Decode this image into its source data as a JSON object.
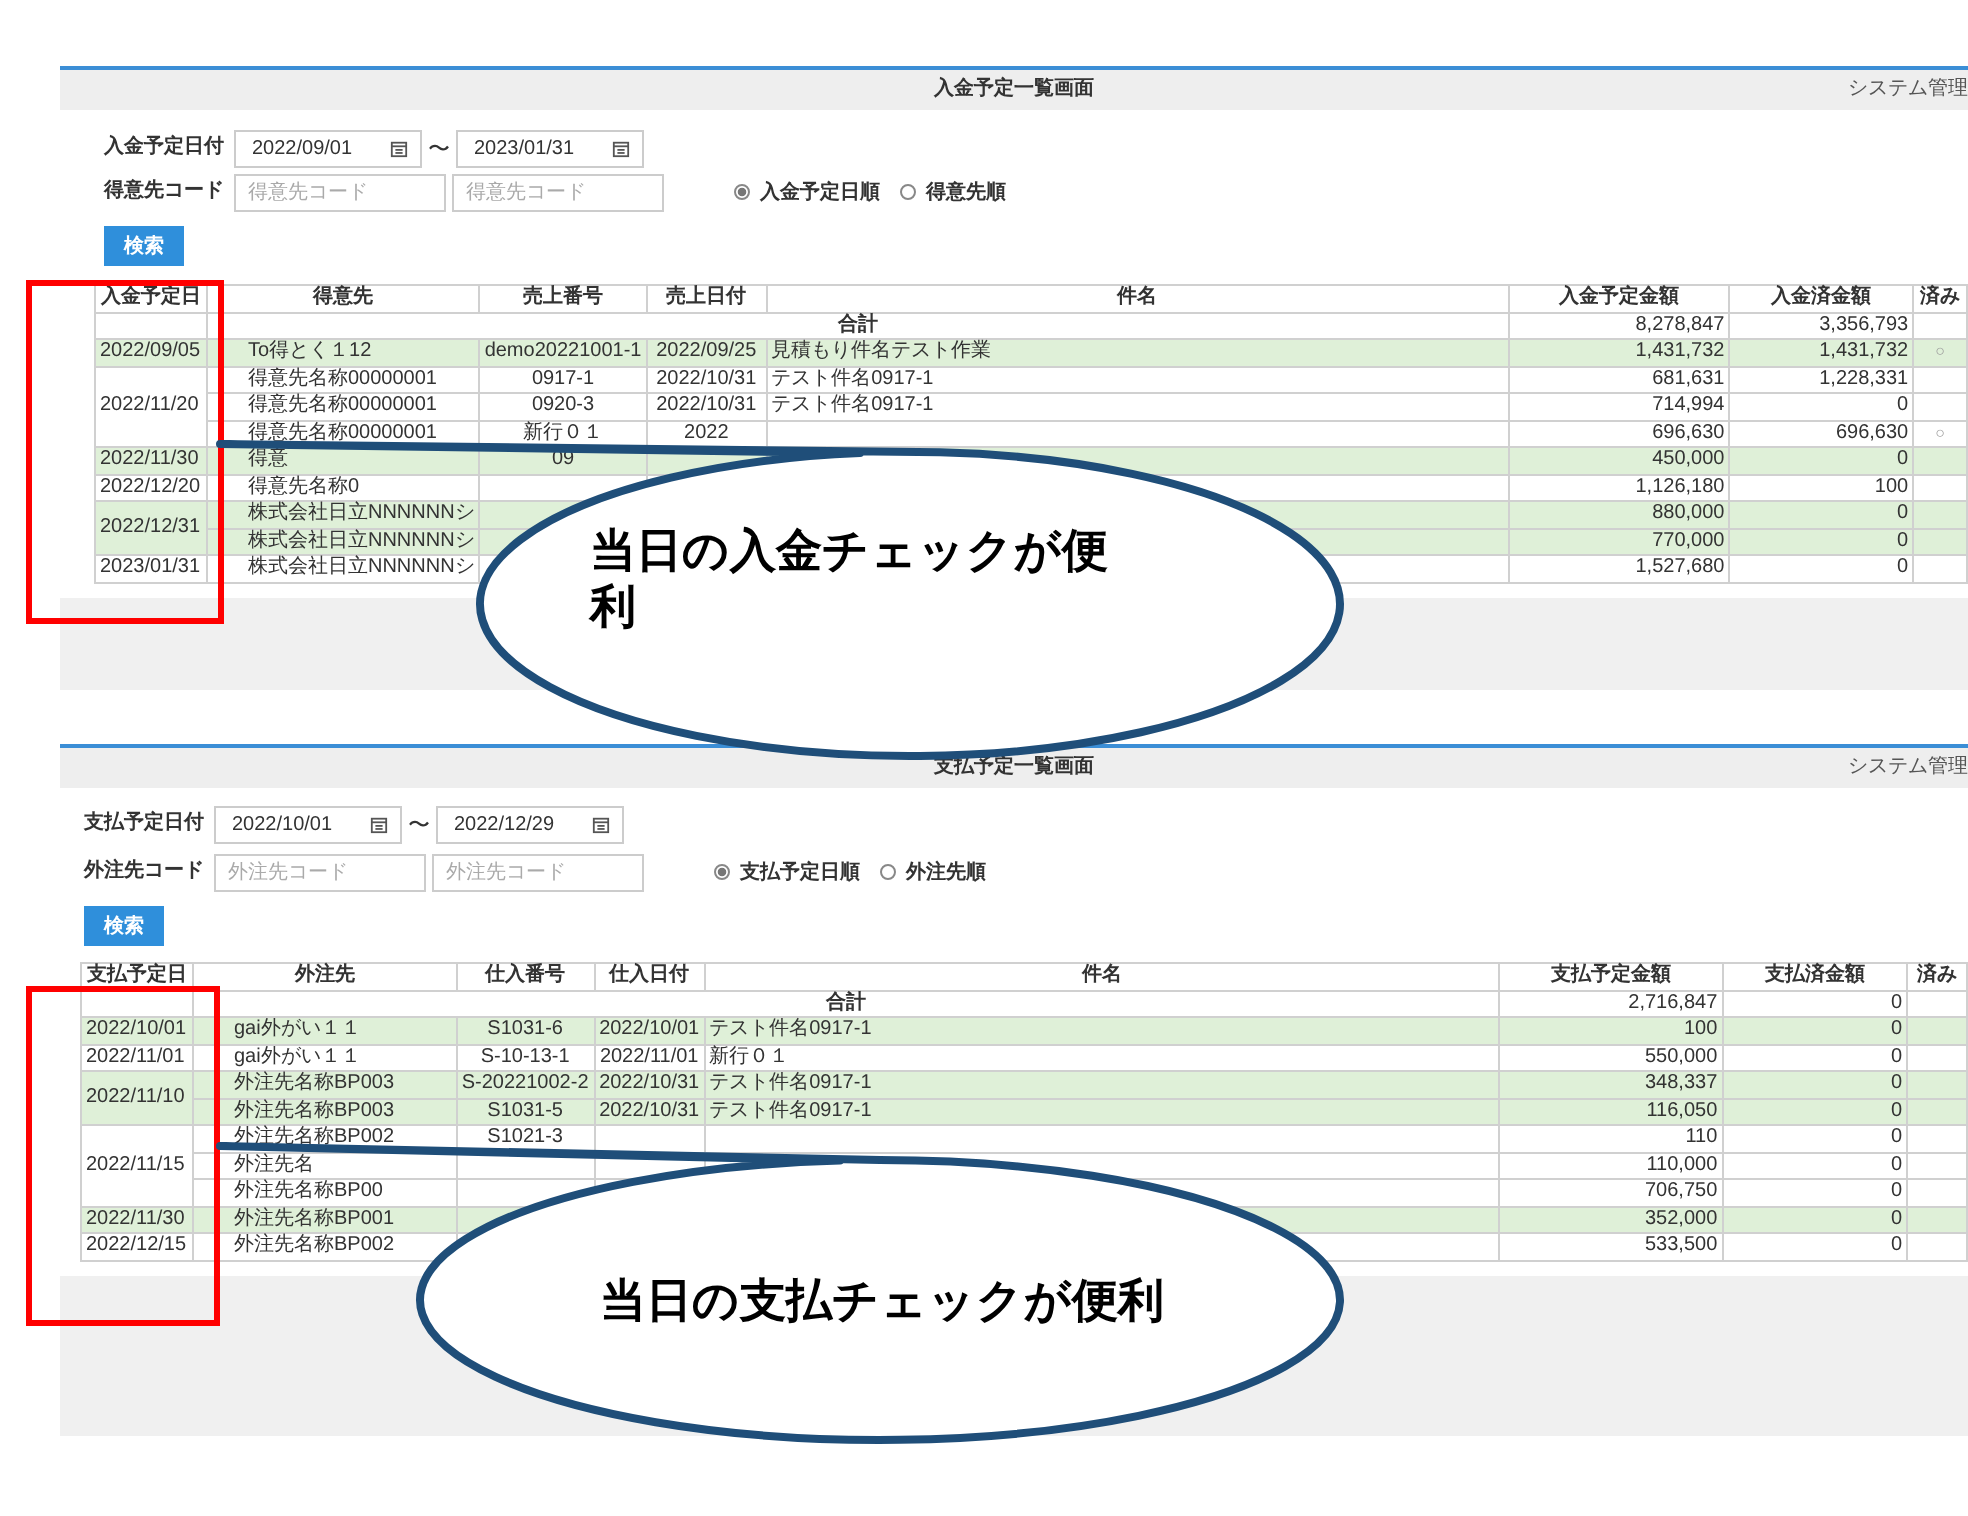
{
  "panels": [
    {
      "title": "入金予定一覧画面",
      "user": "システム管理",
      "date_label": "入金予定日付",
      "date_from": "2022/09/01",
      "range_mark": "〜",
      "date_to": "2023/01/31",
      "code_label": "得意先コード",
      "code_placeholders": [
        "得意先コード",
        "得意先コード"
      ],
      "sort_options": [
        {
          "label": "入金予定日順",
          "selected": true
        },
        {
          "label": "得意先順",
          "selected": false
        }
      ],
      "search_button": "検索",
      "table": {
        "columns": [
          "入金予定日",
          "得意先",
          "売上番号",
          "売上日付",
          "件名",
          "入金予定金額",
          "入金済金額",
          "済み"
        ],
        "total_label": "合計",
        "totals": [
          "8,278,847",
          "3,356,793"
        ],
        "groups": [
          {
            "date": "2022/09/05",
            "highlight": true,
            "lines": [
              {
                "party": "To得とく１12",
                "number": "demo20221001-1",
                "day": "2022/09/25",
                "subject": "見積もり件名テスト作業",
                "amount": "1,431,732",
                "paid": "1,431,732",
                "done": "○"
              }
            ]
          },
          {
            "date": "2022/11/20",
            "highlight": false,
            "lines": [
              {
                "party": "得意先名称00000001",
                "number": "0917-1",
                "day": "2022/10/31",
                "subject": "テスト件名0917-1",
                "amount": "681,631",
                "paid": "1,228,331"
              },
              {
                "party": "得意先名称00000001",
                "number": "0920-3",
                "day": "2022/10/31",
                "subject": "テスト件名0917-1",
                "amount": "714,994",
                "paid": "0"
              },
              {
                "party": "得意先名称00000001",
                "number": "新行０１",
                "day": "2022",
                "amount": "696,630",
                "paid": "696,630",
                "done": "○"
              }
            ]
          },
          {
            "date": "2022/11/30",
            "highlight": true,
            "lines": [
              {
                "party": "得意",
                "number": "09",
                "amount": "450,000",
                "paid": "0"
              }
            ]
          },
          {
            "date": "2022/12/20",
            "highlight": false,
            "lines": [
              {
                "party": "得意先名称0",
                "amount": "1,126,180",
                "paid": "100"
              }
            ]
          },
          {
            "date": "2022/12/31",
            "highlight": true,
            "lines": [
              {
                "party": "株式会社日立NNNNNNシ",
                "amount": "880,000",
                "paid": "0"
              },
              {
                "party": "株式会社日立NNNNNNシ",
                "amount": "770,000",
                "paid": "0"
              }
            ]
          },
          {
            "date": "2023/01/31",
            "highlight": false,
            "lines": [
              {
                "party": "株式会社日立NNNNNNシ",
                "amount": "1,527,680",
                "paid": "0"
              }
            ]
          }
        ]
      },
      "callout": "当日の入金チェックが便利"
    },
    {
      "title": "支払予定一覧画面",
      "user": "システム管理",
      "date_label": "支払予定日付",
      "date_from": "2022/10/01",
      "range_mark": "〜",
      "date_to": "2022/12/29",
      "code_label": "外注先コード",
      "code_placeholders": [
        "外注先コード",
        "外注先コード"
      ],
      "sort_options": [
        {
          "label": "支払予定日順",
          "selected": true
        },
        {
          "label": "外注先順",
          "selected": false
        }
      ],
      "search_button": "検索",
      "table": {
        "columns": [
          "支払予定日",
          "外注先",
          "仕入番号",
          "仕入日付",
          "件名",
          "支払予定金額",
          "支払済金額",
          "済み"
        ],
        "total_label": "合計",
        "totals": [
          "2,716,847",
          "0"
        ],
        "groups": [
          {
            "date": "2022/10/01",
            "highlight": true,
            "lines": [
              {
                "party": "gai外がい１１",
                "number": "S1031-6",
                "day": "2022/10/01",
                "subject": "テスト件名0917-1",
                "amount": "100",
                "paid": "0"
              }
            ]
          },
          {
            "date": "2022/11/01",
            "highlight": false,
            "lines": [
              {
                "party": "gai外がい１１",
                "number": "S-10-13-1",
                "day": "2022/11/01",
                "subject": "新行０１",
                "amount": "550,000",
                "paid": "0"
              }
            ]
          },
          {
            "date": "2022/11/10",
            "highlight": true,
            "lines": [
              {
                "party": "外注先名称BP003",
                "number": "S-20221002-2",
                "day": "2022/10/31",
                "subject": "テスト件名0917-1",
                "amount": "348,337",
                "paid": "0"
              },
              {
                "party": "外注先名称BP003",
                "number": "S1031-5",
                "day": "2022/10/31",
                "subject": "テスト件名0917-1",
                "amount": "116,050",
                "paid": "0"
              }
            ]
          },
          {
            "date": "2022/11/15",
            "highlight": false,
            "lines": [
              {
                "party": "外注先名称BP002",
                "number": "S1021-3",
                "amount": "110",
                "paid": "0"
              },
              {
                "party": "外注先名",
                "amount": "110,000",
                "paid": "0"
              },
              {
                "party": "外注先名称BP00",
                "amount": "706,750",
                "paid": "0"
              }
            ]
          },
          {
            "date": "2022/11/30",
            "highlight": true,
            "lines": [
              {
                "party": "外注先名称BP001",
                "amount": "352,000",
                "paid": "0"
              }
            ]
          },
          {
            "date": "2022/12/15",
            "highlight": false,
            "lines": [
              {
                "party": "外注先名称BP002",
                "amount": "533,500",
                "paid": "0"
              }
            ]
          }
        ]
      },
      "callout": "当日の支払チェックが便利"
    }
  ]
}
